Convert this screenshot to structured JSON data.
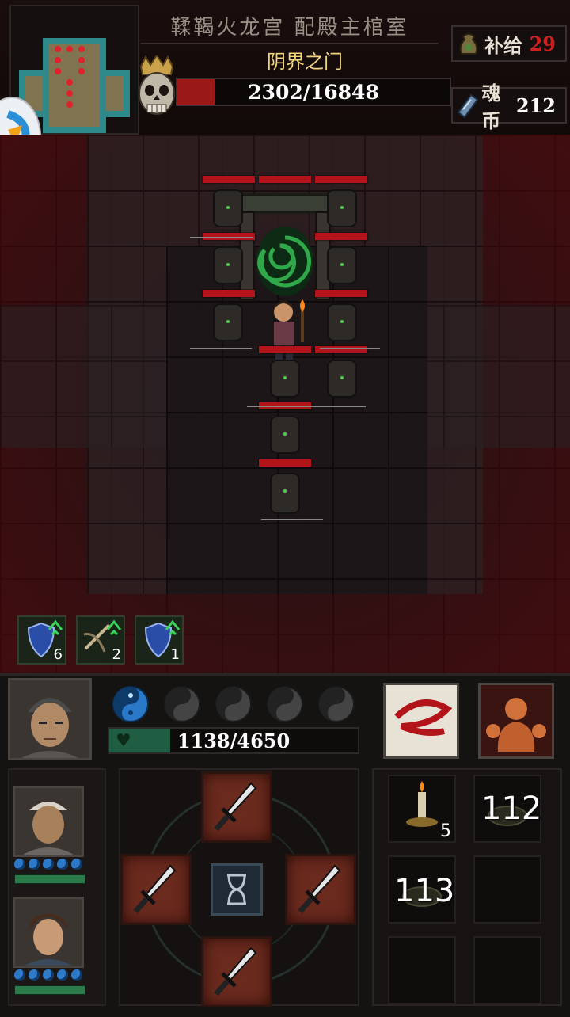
{
  "location": "鞣鞨火龙宫  配殿主棺室",
  "boss": {
    "name": "阴界之门",
    "hp_current": 2302,
    "hp_max": 16848,
    "hp_text": "2302/16848"
  },
  "resources": {
    "supply": {
      "label": "补给",
      "value": "29",
      "color": "#d11f1f"
    },
    "soul_coin": {
      "label": "魂币",
      "value": "212",
      "color": "#ffffff"
    }
  },
  "buffs": [
    {
      "icon": "shield-up-icon",
      "count": "6"
    },
    {
      "icon": "crossbow-up-icon",
      "count": "2"
    },
    {
      "icon": "shield-up-icon",
      "count": "1"
    }
  ],
  "hero": {
    "hp_current": 1138,
    "hp_max": 4650,
    "hp_text": "1138/4650",
    "orbs_total": 5,
    "orbs_active": 1
  },
  "skills": [
    {
      "icon": "whirlwind-slash-icon"
    },
    {
      "icon": "berserker-icon"
    }
  ],
  "team": [
    {
      "icon": "ally-bandana-portrait",
      "orbs": 5,
      "hp_fraction": 1.0
    },
    {
      "icon": "ally-brown-hair-portrait",
      "orbs": 5,
      "hp_fraction": 1.0
    }
  ],
  "actions": [
    {
      "icon": "dagger-icon",
      "dir": "up"
    },
    {
      "icon": "dagger-icon",
      "dir": "left"
    },
    {
      "icon": "hourglass-icon",
      "dir": "wait"
    },
    {
      "icon": "dagger-icon",
      "dir": "right"
    },
    {
      "icon": "dagger-icon",
      "dir": "down"
    }
  ],
  "inventory": [
    {
      "icon": "candle-icon",
      "count": "5"
    },
    {
      "icon": "plate-icon",
      "count": "112"
    },
    {
      "icon": "plate-icon",
      "count": "113"
    },
    {
      "icon": "empty-slot",
      "count": ""
    },
    {
      "icon": "empty-slot",
      "count": ""
    },
    {
      "icon": "empty-slot",
      "count": ""
    }
  ],
  "colors": {
    "boss_hp": "#9a1818",
    "hero_hp": "#1f5e43",
    "enemy_hp": "#b3141a",
    "orb_active": "#2f7ac8",
    "title_gold": "#f3d57c"
  }
}
